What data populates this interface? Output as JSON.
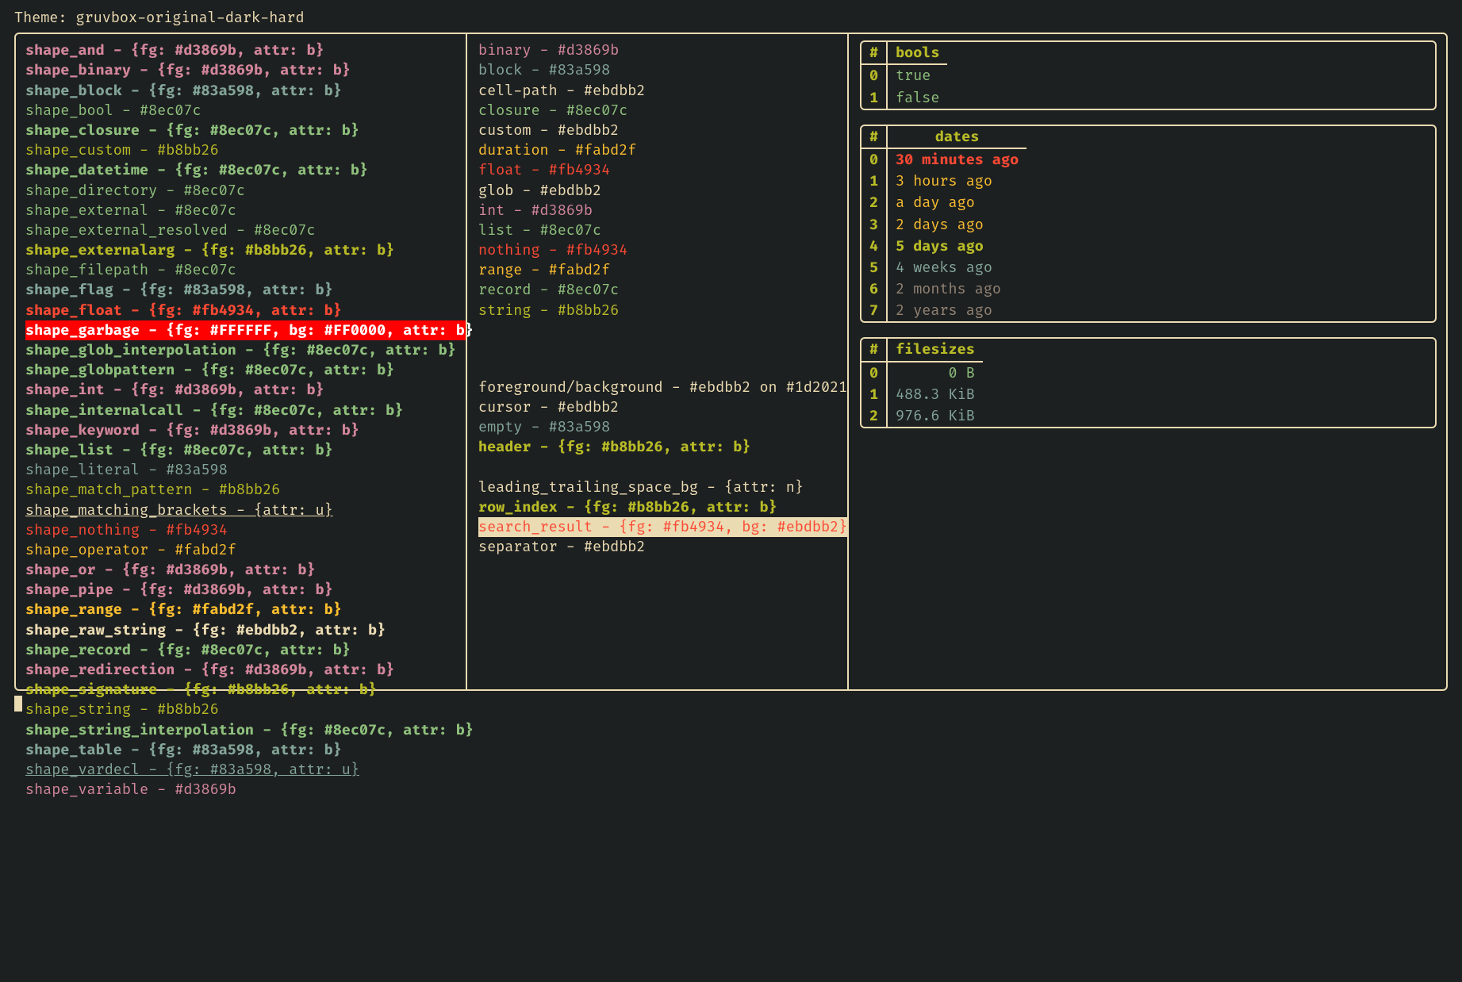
{
  "title": "Theme: gruvbox-original-dark-hard",
  "palette": {
    "fg": "#ebdbb2",
    "bg": "#1d2021",
    "green": "#8ec07c",
    "yellow": "#b8bb26",
    "orange": "#fabd2f",
    "red": "#fb4934",
    "purple": "#d3869b",
    "blue": "#83a598",
    "gray": "#928374",
    "white": "#FFFFFF",
    "err_bg": "#FF0000"
  },
  "shapes": [
    {
      "name": "shape_and",
      "val": "{fg: #d3869b, attr: b}",
      "fg": "#d3869b",
      "bold": true
    },
    {
      "name": "shape_binary",
      "val": "{fg: #d3869b, attr: b}",
      "fg": "#d3869b",
      "bold": true
    },
    {
      "name": "shape_block",
      "val": "{fg: #83a598, attr: b}",
      "fg": "#83a598",
      "bold": true
    },
    {
      "name": "shape_bool",
      "val": "#8ec07c",
      "fg": "#8ec07c"
    },
    {
      "name": "shape_closure",
      "val": "{fg: #8ec07c, attr: b}",
      "fg": "#8ec07c",
      "bold": true
    },
    {
      "name": "shape_custom",
      "val": "#b8bb26",
      "fg": "#b8bb26"
    },
    {
      "name": "shape_datetime",
      "val": "{fg: #8ec07c, attr: b}",
      "fg": "#8ec07c",
      "bold": true
    },
    {
      "name": "shape_directory",
      "val": "#8ec07c",
      "fg": "#8ec07c"
    },
    {
      "name": "shape_external",
      "val": "#8ec07c",
      "fg": "#8ec07c"
    },
    {
      "name": "shape_external_resolved",
      "val": "#8ec07c",
      "fg": "#8ec07c"
    },
    {
      "name": "shape_externalarg",
      "val": "{fg: #b8bb26, attr: b}",
      "fg": "#b8bb26",
      "bold": true
    },
    {
      "name": "shape_filepath",
      "val": "#8ec07c",
      "fg": "#8ec07c"
    },
    {
      "name": "shape_flag",
      "val": "{fg: #83a598, attr: b}",
      "fg": "#83a598",
      "bold": true
    },
    {
      "name": "shape_float",
      "val": "{fg: #fb4934, attr: b}",
      "fg": "#fb4934",
      "bold": true
    },
    {
      "name": "shape_garbage",
      "val": "{fg: #FFFFFF, bg: #FF0000, attr: b}",
      "fg": "#FFFFFF",
      "bg": "#FF0000",
      "bold": true
    },
    {
      "name": "shape_glob_interpolation",
      "val": "{fg: #8ec07c, attr: b}",
      "fg": "#8ec07c",
      "bold": true
    },
    {
      "name": "shape_globpattern",
      "val": "{fg: #8ec07c, attr: b}",
      "fg": "#8ec07c",
      "bold": true
    },
    {
      "name": "shape_int",
      "val": "{fg: #d3869b, attr: b}",
      "fg": "#d3869b",
      "bold": true
    },
    {
      "name": "shape_internalcall",
      "val": "{fg: #8ec07c, attr: b}",
      "fg": "#8ec07c",
      "bold": true
    },
    {
      "name": "shape_keyword",
      "val": "{fg: #d3869b, attr: b}",
      "fg": "#d3869b",
      "bold": true
    },
    {
      "name": "shape_list",
      "val": "{fg: #8ec07c, attr: b}",
      "fg": "#8ec07c",
      "bold": true
    },
    {
      "name": "shape_literal",
      "val": "#83a598",
      "fg": "#83a598"
    },
    {
      "name": "shape_match_pattern",
      "val": "#b8bb26",
      "fg": "#b8bb26"
    },
    {
      "name": "shape_matching_brackets",
      "val": "{attr: u}",
      "fg": "#ebdbb2",
      "underline": true
    },
    {
      "name": "shape_nothing",
      "val": "#fb4934",
      "fg": "#fb4934"
    },
    {
      "name": "shape_operator",
      "val": "#fabd2f",
      "fg": "#fabd2f"
    },
    {
      "name": "shape_or",
      "val": "{fg: #d3869b, attr: b}",
      "fg": "#d3869b",
      "bold": true
    },
    {
      "name": "shape_pipe",
      "val": "{fg: #d3869b, attr: b}",
      "fg": "#d3869b",
      "bold": true
    },
    {
      "name": "shape_range",
      "val": "{fg: #fabd2f, attr: b}",
      "fg": "#fabd2f",
      "bold": true
    },
    {
      "name": "shape_raw_string",
      "val": "{fg: #ebdbb2, attr: b}",
      "fg": "#ebdbb2",
      "bold": true
    },
    {
      "name": "shape_record",
      "val": "{fg: #8ec07c, attr: b}",
      "fg": "#8ec07c",
      "bold": true
    },
    {
      "name": "shape_redirection",
      "val": "{fg: #d3869b, attr: b}",
      "fg": "#d3869b",
      "bold": true
    },
    {
      "name": "shape_signature",
      "val": "{fg: #b8bb26, attr: b}",
      "fg": "#b8bb26",
      "bold": true
    },
    {
      "name": "shape_string",
      "val": "#b8bb26",
      "fg": "#b8bb26"
    },
    {
      "name": "shape_string_interpolation",
      "val": "{fg: #8ec07c, attr: b}",
      "fg": "#8ec07c",
      "bold": true
    },
    {
      "name": "shape_table",
      "val": "{fg: #83a598, attr: b}",
      "fg": "#83a598",
      "bold": true
    },
    {
      "name": "shape_vardecl",
      "val": "{fg: #83a598, attr: u}",
      "fg": "#83a598",
      "underline": true
    },
    {
      "name": "shape_variable",
      "val": "#d3869b",
      "fg": "#d3869b"
    }
  ],
  "types": [
    {
      "name": "binary",
      "val": "#d3869b",
      "fg": "#d3869b"
    },
    {
      "name": "block",
      "val": "#83a598",
      "fg": "#83a598"
    },
    {
      "name": "cell-path",
      "val": "#ebdbb2",
      "fg": "#ebdbb2"
    },
    {
      "name": "closure",
      "val": "#8ec07c",
      "fg": "#8ec07c"
    },
    {
      "name": "custom",
      "val": "#ebdbb2",
      "fg": "#ebdbb2"
    },
    {
      "name": "duration",
      "val": "#fabd2f",
      "fg": "#fabd2f"
    },
    {
      "name": "float",
      "val": "#fb4934",
      "fg": "#fb4934"
    },
    {
      "name": "glob",
      "val": "#ebdbb2",
      "fg": "#ebdbb2"
    },
    {
      "name": "int",
      "val": "#d3869b",
      "fg": "#d3869b"
    },
    {
      "name": "list",
      "val": "#8ec07c",
      "fg": "#8ec07c"
    },
    {
      "name": "nothing",
      "val": "#fb4934",
      "fg": "#fb4934"
    },
    {
      "name": "range",
      "val": "#fabd2f",
      "fg": "#fabd2f"
    },
    {
      "name": "record",
      "val": "#8ec07c",
      "fg": "#8ec07c"
    },
    {
      "name": "string",
      "val": "#b8bb26",
      "fg": "#b8bb26"
    }
  ],
  "misc": [
    {
      "name": "foreground/background",
      "val": "#ebdbb2 on #1d2021",
      "fg": "#ebdbb2"
    },
    {
      "name": "cursor",
      "val": "#ebdbb2",
      "fg": "#ebdbb2"
    },
    {
      "name": "empty",
      "val": "#83a598",
      "fg": "#83a598"
    },
    {
      "name": "header",
      "val": "{fg: #b8bb26, attr: b}",
      "fg": "#b8bb26",
      "bold": true
    },
    {
      "spacer": true
    },
    {
      "name": "leading_trailing_space_bg",
      "val": "{attr: n}",
      "fg": "#ebdbb2"
    },
    {
      "name": "row_index",
      "val": "{fg: #b8bb26, attr: b}",
      "fg": "#b8bb26",
      "bold": true
    },
    {
      "name": "search_result",
      "val": "{fg: #fb4934, bg: #ebdbb2}",
      "fg": "#fb4934",
      "bg": "#ebdbb2"
    },
    {
      "name": "separator",
      "val": "#ebdbb2",
      "fg": "#ebdbb2"
    }
  ],
  "bools_table": {
    "header": "bools",
    "rows": [
      {
        "idx": "0",
        "val": "true",
        "fg": "#8ec07c"
      },
      {
        "idx": "1",
        "val": "false",
        "fg": "#8ec07c"
      }
    ]
  },
  "dates_table": {
    "header": "dates",
    "rows": [
      {
        "idx": "0",
        "val": "30 minutes ago",
        "fg": "#fb4934",
        "bold": true
      },
      {
        "idx": "1",
        "val": "3 hours ago",
        "fg": "#fabd2f"
      },
      {
        "idx": "2",
        "val": "a day ago",
        "fg": "#fabd2f"
      },
      {
        "idx": "3",
        "val": "2 days ago",
        "fg": "#fabd2f"
      },
      {
        "idx": "4",
        "val": "5 days ago",
        "fg": "#b8bb26",
        "bold": true
      },
      {
        "idx": "5",
        "val": "4 weeks ago",
        "fg": "#83a598"
      },
      {
        "idx": "6",
        "val": "2 months ago",
        "fg": "#928374"
      },
      {
        "idx": "7",
        "val": "2 years ago",
        "fg": "#928374"
      }
    ]
  },
  "filesizes_table": {
    "header": "filesizes",
    "rows": [
      {
        "idx": "0",
        "val": "      0 B",
        "fg": "#8ec07c"
      },
      {
        "idx": "1",
        "val": "488.3 KiB",
        "fg": "#83a598"
      },
      {
        "idx": "2",
        "val": "976.6 KiB",
        "fg": "#83a598"
      }
    ]
  }
}
